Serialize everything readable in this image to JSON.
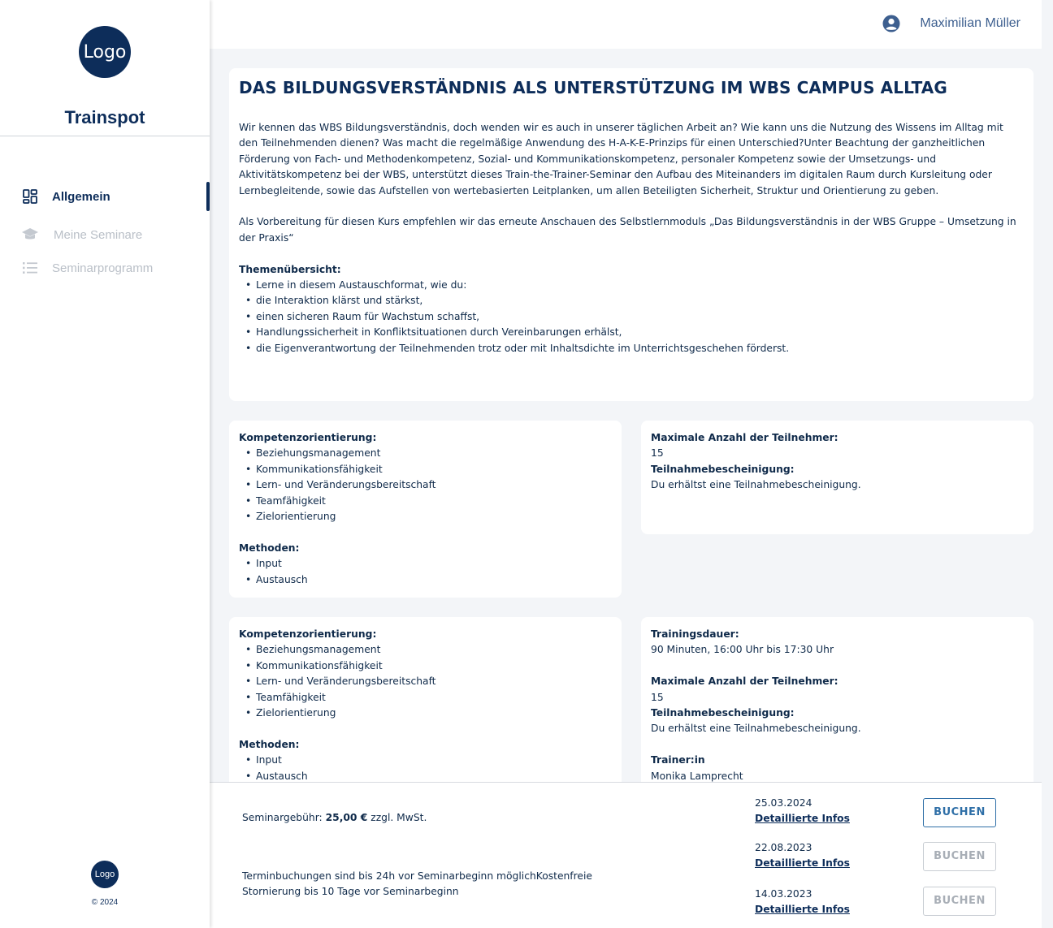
{
  "sidebar": {
    "logo_text": "Logo",
    "brand": "Trainspot",
    "items": [
      {
        "label": "Allgemein",
        "icon": "dashboard-icon"
      },
      {
        "label": "Meine Seminare",
        "icon": "graduation-cap-icon"
      },
      {
        "label": "Seminarprogramm",
        "icon": "list-icon"
      }
    ],
    "footer_logo": "Logo",
    "copyright": "© 2024"
  },
  "header": {
    "user_name": "Maximilian Müller",
    "user_icon": "user-circle-icon"
  },
  "main": {
    "title": "DAS BILDUNGSVERSTÄNDNIS ALS UNTERSTÜTZUNG IM WBS CAMPUS ALLTAG",
    "paragraph1": "Wir kennen das WBS Bildungsverständnis, doch wenden wir es auch in unserer täglichen Arbeit an? Wie kann uns die Nutzung des Wissens im Alltag mit den Teilnehmenden dienen? Was macht die regelmäßige Anwendung des H-A-K-E-Prinzips für einen Unterschied?Unter Beachtung der ganzheitlichen Förderung von Fach- und Methodenkompetenz, Sozial- und Kommunikationskompetenz, personaler Kompetenz sowie der Umsetzungs- und Aktivitätskompetenz bei der WBS, unterstützt dieses Train-the-Trainer-Seminar den Aufbau des Miteinanders im digitalen Raum durch Kursleitung oder Lernbegleitende, sowie das Aufstellen von wertebasierten Leitplanken, um allen Beteiligten Sicherheit, Struktur und Orientierung zu geben.",
    "paragraph2": "Als Vorbereitung für diesen Kurs empfehlen wir das erneute Anschauen des Selbstlernmoduls „Das Bildungsverständnis in der WBS Gruppe – Umsetzung in der Praxis“",
    "topics_heading": "Themenübersicht:",
    "topics": [
      "Lerne in diesem Austauschformat, wie du:",
      "die Interaktion klärst und stärkst,",
      "einen sicheren Raum für Wachstum schaffst,",
      "Handlungssicherheit in Konfliktsituationen durch Vereinbarungen erhälst,",
      "die Eigenverantwortung der Teilnehmenden trotz oder mit Inhaltsdichte im Unterrichtsgeschehen förderst."
    ]
  },
  "block1": {
    "competence_heading": "Kompetenzorientierung:",
    "competences": [
      "Beziehungsmanagement",
      "Kommunikationsfähigkeit",
      "Lern- und Veränderungsbereitschaft",
      "Teamfähigkeit",
      "Zielorientierung"
    ],
    "methods_heading": "Methoden:",
    "methods": [
      "Input",
      "Austausch"
    ],
    "max_heading": "Maximale Anzahl der Teilnehmer:",
    "max_value": "15",
    "cert_heading": "Teilnahmebescheinigung:",
    "cert_value": "Du erhältst eine Teilnahmebescheinigung."
  },
  "block2": {
    "competence_heading": "Kompetenzorientierung:",
    "competences": [
      "Beziehungsmanagement",
      "Kommunikationsfähigkeit",
      "Lern- und Veränderungsbereitschaft",
      "Teamfähigkeit",
      "Zielorientierung"
    ],
    "methods_heading": "Methoden:",
    "methods": [
      "Input",
      "Austausch"
    ],
    "duration_heading": "Trainingsdauer:",
    "duration_value": "90 Minuten, 16:00 Uhr bis 17:30 Uhr",
    "max_heading": "Maximale Anzahl der Teilnehmer:",
    "max_value": "15",
    "cert_heading": "Teilnahmebescheinigung:",
    "cert_value": "Du erhältst eine Teilnahmebescheinigung.",
    "trainer_heading": "Trainer:in",
    "trainer_value": "Monika Lamprecht"
  },
  "footer": {
    "fee_label": "Seminargebühr: ",
    "fee_value": "25,00 €",
    "fee_suffix": " zzgl. MwSt.",
    "terms": "Terminbuchungen sind bis 24h vor Seminarbeginn möglichKostenfreie Stornierung bis 10 Tage vor Seminarbeginn",
    "dates": [
      {
        "date": "25.03.2024",
        "link": "Detaillierte Infos",
        "button": "BUCHEN",
        "enabled": true
      },
      {
        "date": "22.08.2023",
        "link": "Detaillierte Infos",
        "button": "BUCHEN",
        "enabled": false
      },
      {
        "date": "14.03.2023",
        "link": "Detaillierte Infos",
        "button": "BUCHEN",
        "enabled": false
      }
    ]
  }
}
